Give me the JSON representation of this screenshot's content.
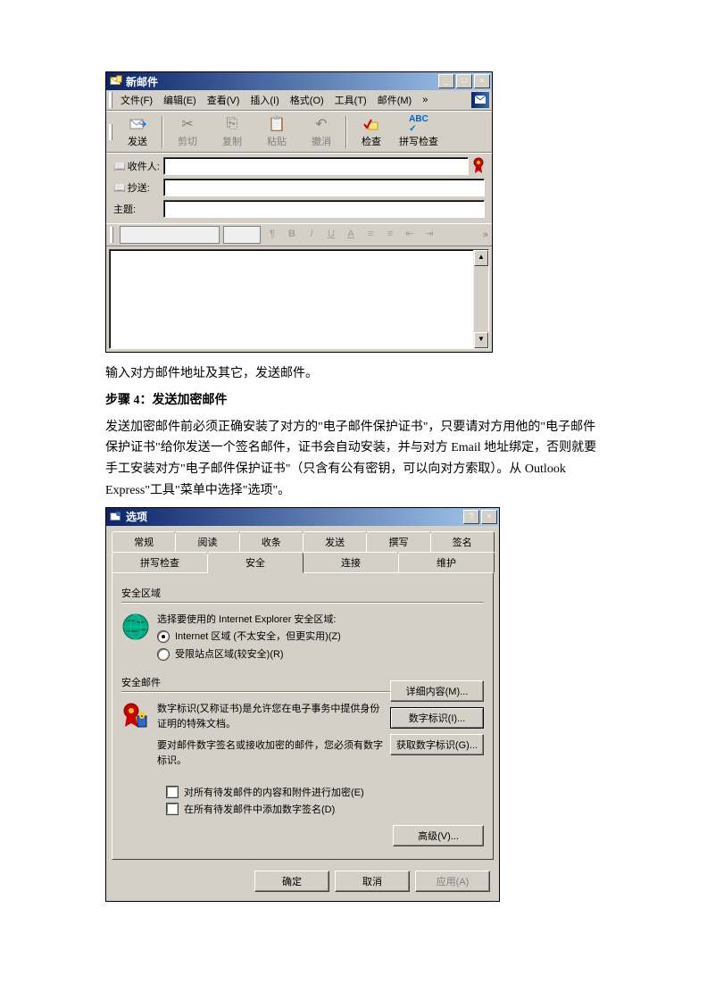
{
  "newmail": {
    "title": "新邮件",
    "menu": {
      "file": "文件(F)",
      "edit": "编辑(E)",
      "view": "查看(V)",
      "insert": "插入(I)",
      "format": "格式(O)",
      "tools": "工具(T)",
      "mail": "邮件(M)",
      "overflow": "»"
    },
    "toolbar": {
      "send": "发送",
      "cut": "剪切",
      "copy": "复制",
      "paste": "粘贴",
      "undo": "撤消",
      "check": "检查",
      "spell": "拼写检查"
    },
    "fields": {
      "to": "收件人:",
      "cc": "抄送:",
      "subject": "主题:"
    },
    "winctrls": {
      "min": "_",
      "max": "□",
      "close": "×"
    }
  },
  "text": {
    "p1": "输入对方邮件地址及其它，发送邮件。",
    "step": "步骤 4：发送加密邮件",
    "p2": "发送加密邮件前必须正确安装了对方的\"电子邮件保护证书\"，只要请对方用他的\"电子邮件保护证书\"给你发送一个签名邮件，证书会自动安装，并与对方 Email 地址绑定，否则就要手工安装对方\"电子邮件保护证书\"（只含有公有密钥，可以向对方索取）。从 Outlook Express\"工具\"菜单中选择\"选项\"。"
  },
  "options": {
    "title": "选项",
    "help": "?",
    "close": "×",
    "tabs_row1": [
      "常规",
      "阅读",
      "收条",
      "发送",
      "撰写",
      "签名"
    ],
    "tabs_row2": [
      "拼写检查",
      "安全",
      "连接",
      "维护"
    ],
    "active_tab": "安全",
    "zone": {
      "group": "安全区域",
      "desc": "选择要使用的 Internet Explorer 安全区域:",
      "opt1": "Internet 区域 (不太安全，但更实用)(Z)",
      "opt2": "受限站点区域(较安全)(R)"
    },
    "mail": {
      "group": "安全邮件",
      "desc1": "数字标识(又称证书)是允许您在电子事务中提供身份证明的特殊文档。",
      "desc2": "要对邮件数字签名或接收加密的邮件，您必须有数字标识。",
      "btn_more": "详细内容(M)...",
      "btn_id": "数字标识(I)...",
      "btn_get": "获取数字标识(G)...",
      "chk1": "对所有待发邮件的内容和附件进行加密(E)",
      "chk2": "在所有待发邮件中添加数字签名(D)",
      "btn_adv": "高级(V)..."
    },
    "dlg_btns": {
      "ok": "确定",
      "cancel": "取消",
      "apply": "应用(A)"
    }
  }
}
